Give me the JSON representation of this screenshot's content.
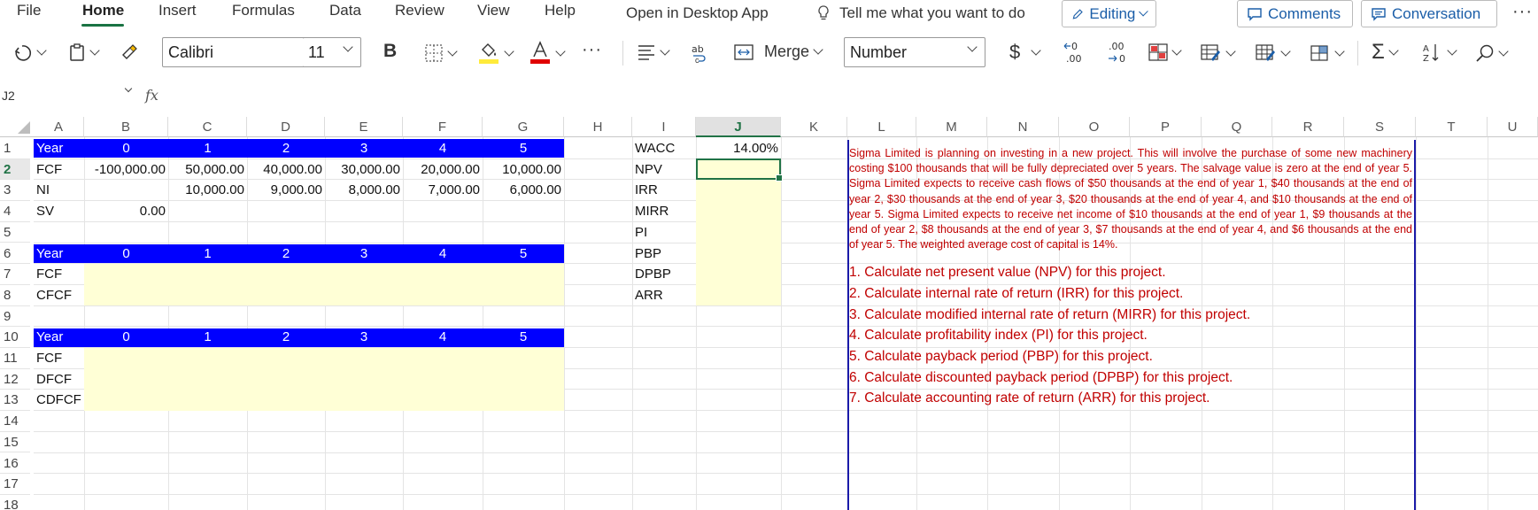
{
  "menu": {
    "items": [
      "File",
      "Home",
      "Insert",
      "Formulas",
      "Data",
      "Review",
      "View",
      "Help"
    ],
    "open_desktop": "Open in Desktop App",
    "tell_me": "Tell me what you want to do",
    "editing": "Editing",
    "comments": "Comments",
    "conversation": "Conversation",
    "more": "···"
  },
  "ribbon": {
    "font_name": "Calibri",
    "font_size": "11",
    "bold": "B",
    "merge": "Merge",
    "number_format": "Number",
    "currency": "$",
    "more": "···",
    "highlight_color": "#ffeb3b",
    "font_color": "#e00000"
  },
  "formula_bar": {
    "name_box": "J2",
    "fx": "fx",
    "value": ""
  },
  "columns": [
    "A",
    "B",
    "C",
    "D",
    "E",
    "F",
    "G",
    "H",
    "I",
    "J",
    "K",
    "L",
    "M",
    "N",
    "O",
    "P",
    "Q",
    "R",
    "S",
    "T",
    "U"
  ],
  "rows": [
    "1",
    "2",
    "3",
    "4",
    "5",
    "6",
    "7",
    "8",
    "9",
    "10",
    "11",
    "12",
    "13",
    "14",
    "15",
    "16",
    "17",
    "18"
  ],
  "table1": {
    "year_label": "Year",
    "years": [
      "0",
      "1",
      "2",
      "3",
      "4",
      "5"
    ],
    "fcf_label": "FCF",
    "fcf": [
      "-100,000.00",
      "50,000.00",
      "40,000.00",
      "30,000.00",
      "20,000.00",
      "10,000.00"
    ],
    "ni_label": "NI",
    "ni": [
      "10,000.00",
      "9,000.00",
      "8,000.00",
      "7,000.00",
      "6,000.00"
    ],
    "sv_label": "SV",
    "sv": "0.00"
  },
  "table2": {
    "year_label": "Year",
    "years": [
      "0",
      "1",
      "2",
      "3",
      "4",
      "5"
    ],
    "row_labels": [
      "FCF",
      "CFCF"
    ]
  },
  "table3": {
    "year_label": "Year",
    "years": [
      "0",
      "1",
      "2",
      "3",
      "4",
      "5"
    ],
    "row_labels": [
      "FCF",
      "DFCF",
      "CDFCF"
    ]
  },
  "metrics": {
    "labels": [
      "WACC",
      "NPV",
      "IRR",
      "MIRR",
      "PI",
      "PBP",
      "DPBP",
      "ARR"
    ],
    "wacc_value": "14.00%"
  },
  "problem": {
    "text": "Sigma Limited is planning on investing in a new project. This will involve the purchase of some new machinery costing $100 thousands that will be fully depreciated over 5 years. The salvage value is zero at the end of year 5. Sigma Limited expects to receive cash flows of $50 thousands at the end of year 1, $40 thousands at the end of year 2, $30 thousands at the end of year 3, $20 thousands at the end of year 4, and $10 thousands at the end of year 5. Sigma Limited expects to receive net income of $10 thousands at the end of year 1, $9 thousands at the end of year 2, $8 thousands at the end of year 3, $7 thousands at the end of year 4, and $6 thousands at the end of year 5. The weighted average cost of capital is 14%.",
    "tasks": [
      "1. Calculate net present value (NPV) for this project.",
      "2. Calculate internal rate of return (IRR) for this project.",
      "3. Calculate modified internal rate of return (MIRR) for this project.",
      "4. Calculate profitability index (PI) for this project.",
      "5. Calculate payback period (PBP) for this project.",
      "6. Calculate discounted payback period (DPBP) for this project.",
      "7. Calculate accounting rate of return (ARR) for this project."
    ]
  },
  "colors": {
    "header_band": "#0000ff",
    "input_fill": "#ffffd6",
    "problem_text": "#c00000",
    "accent": "#217346"
  }
}
